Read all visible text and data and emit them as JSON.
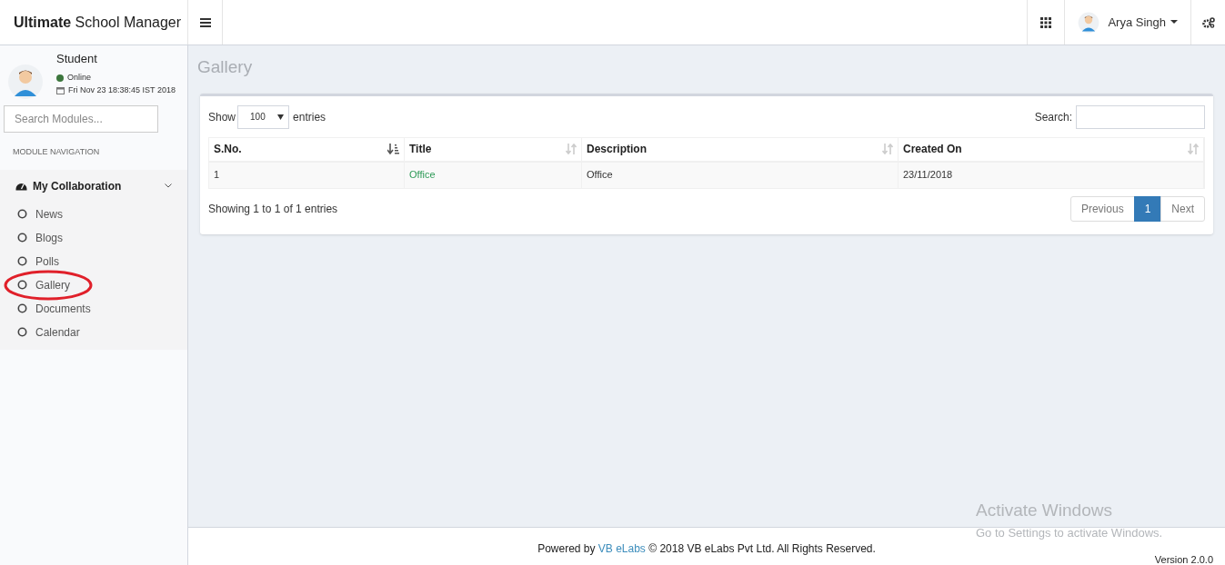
{
  "header": {
    "brand_bold": "Ultimate",
    "brand_rest": "School Manager",
    "user_name": "Arya Singh"
  },
  "sidebar": {
    "user": {
      "role": "Student",
      "status": "Online",
      "datetime": "Fri Nov 23 18:38:45 IST 2018"
    },
    "search": {
      "placeholder": "Search Modules..."
    },
    "section_label": "MODULE NAVIGATION",
    "group": {
      "label": "My Collaboration",
      "expanded": true,
      "items": [
        {
          "label": "News",
          "annotated": false
        },
        {
          "label": "Blogs",
          "annotated": false
        },
        {
          "label": "Polls",
          "annotated": false
        },
        {
          "label": "Gallery",
          "annotated": true
        },
        {
          "label": "Documents",
          "annotated": false
        },
        {
          "label": "Calendar",
          "annotated": false
        }
      ]
    }
  },
  "page_title": "Gallery",
  "table": {
    "show_label": "Show",
    "page_size": "100",
    "entries_label": "entries",
    "search_label": "Search:",
    "columns": [
      {
        "label": "S.No.",
        "sorted": true
      },
      {
        "label": "Title",
        "sorted": false
      },
      {
        "label": "Description",
        "sorted": false
      },
      {
        "label": "Created On",
        "sorted": false
      }
    ],
    "rows": [
      {
        "cells": [
          "1",
          "Office",
          "Office",
          "23/11/2018"
        ]
      }
    ],
    "info": "Showing 1 to 1 of 1 entries",
    "pagination": [
      {
        "label": "Previous",
        "selected": false
      },
      {
        "label": "1",
        "selected": true
      },
      {
        "label": "Next",
        "selected": false
      }
    ]
  },
  "footer": {
    "powered_by": "Powered by",
    "link": "VB eLabs",
    "copyright": "© 2018 VB eLabs Pvt Ltd. All Rights Reserved.",
    "version": "Version 2.0.0"
  },
  "os_overlay": {
    "title": "Activate Windows",
    "message": "Go to Settings to activate Windows."
  }
}
